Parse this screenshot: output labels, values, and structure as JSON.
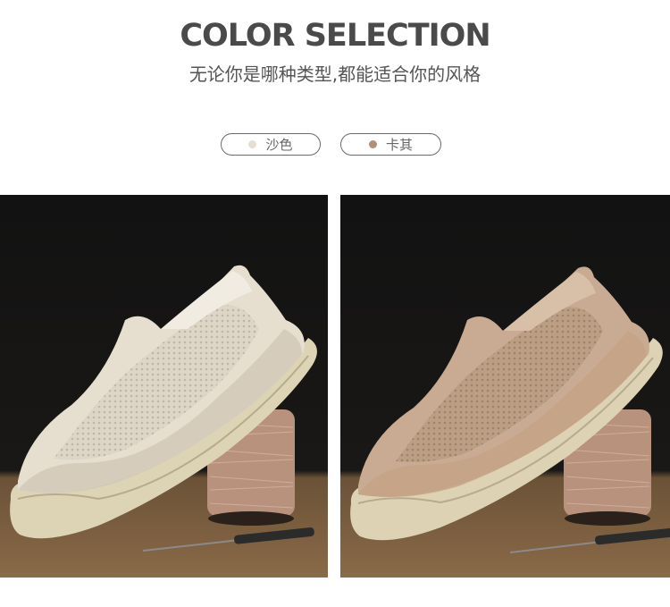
{
  "header": {
    "title": "COLOR SELECTION",
    "subtitle": "无论你是哪种类型,都能适合你的风格"
  },
  "colors": [
    {
      "label": "沙色",
      "swatch": "#e4dfd2"
    },
    {
      "label": "卡其",
      "swatch": "#b58e73"
    }
  ],
  "photos": [
    {
      "variant": "sand",
      "upper": "#e6dfd0",
      "mesh": "#d9d1c2",
      "trim": "#cfc6b5",
      "sole": "#ddd4b6"
    },
    {
      "variant": "khaki",
      "upper": "#c8ab92",
      "mesh": "#b89a80",
      "trim": "#c4a286",
      "sole": "#ddd2b4"
    }
  ]
}
